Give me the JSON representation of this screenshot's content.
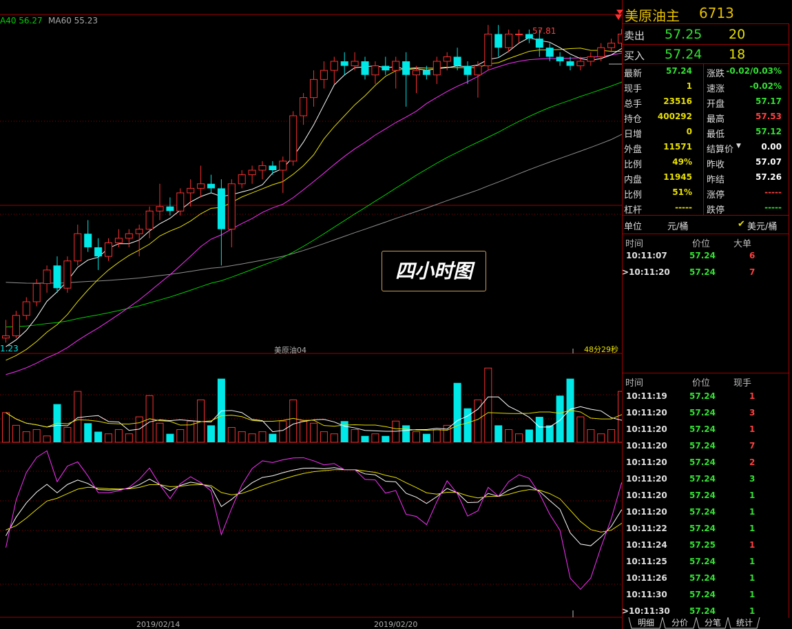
{
  "chart_header": {
    "ma40_label": "A40 56.27",
    "ma60_label": "MA60 55.23",
    "high_mark": "57.81",
    "low_mark": "1.23",
    "contract_label": "美原油04",
    "countdown": "48分29秒",
    "x_labels": [
      "2019/02/14",
      "2019/02/20"
    ]
  },
  "watermark": "四小时图",
  "colors": {
    "up": "#ff3030",
    "down": "#00e8e8",
    "ma5": "#ffffff",
    "ma10": "#e8e000",
    "ma20": "#ff30ff",
    "ma40": "#00d000",
    "ma60": "#909090",
    "grid": "#a00000"
  },
  "panel": {
    "title": "美原油主",
    "code": "6713",
    "ask_label": "卖出",
    "ask_price": "57.25",
    "ask_qty": "20",
    "bid_label": "买入",
    "bid_price": "57.24",
    "bid_qty": "18",
    "quote": [
      {
        "l": "最新",
        "v": "57.24",
        "c": "#33e033",
        "l2": "涨跌",
        "v2": "-0.02/0.03%",
        "c2": "#33e033"
      },
      {
        "l": "现手",
        "v": "1",
        "c": "#e8e000",
        "l2": "速涨",
        "v2": "-0.02%",
        "c2": "#33e033"
      },
      {
        "l": "总手",
        "v": "23516",
        "c": "#e8e000",
        "l2": "开盘",
        "v2": "57.17",
        "c2": "#33e033"
      },
      {
        "l": "持仓",
        "v": "400292",
        "c": "#e8e000",
        "l2": "最高",
        "v2": "57.53",
        "c2": "#ff4040"
      },
      {
        "l": "日增",
        "v": "0",
        "c": "#e8e000",
        "l2": "最低",
        "v2": "57.12",
        "c2": "#33e033"
      },
      {
        "l": "外盘",
        "v": "11571",
        "c": "#e8e000",
        "l2": "结算价",
        "v2": "0.00",
        "c2": "#ffffff"
      },
      {
        "l": "比例",
        "v": "49%",
        "c": "#e8e000",
        "l2": "昨收",
        "v2": "57.07",
        "c2": "#ffffff"
      },
      {
        "l": "内盘",
        "v": "11945",
        "c": "#e8e000",
        "l2": "昨结",
        "v2": "57.26",
        "c2": "#ffffff"
      },
      {
        "l": "比例",
        "v": "51%",
        "c": "#e8e000",
        "l2": "涨停",
        "v2": "-----",
        "c2": "#ff4040"
      },
      {
        "l": "杠杆",
        "v": "-----",
        "c": "#e8e000",
        "l2": "跌停",
        "v2": "-----",
        "c2": "#33e033"
      }
    ],
    "unit_label": "单位",
    "unit_a": "元/桶",
    "unit_b": "美元/桶",
    "big_head": [
      "时间",
      "价位",
      "大单"
    ],
    "big_orders": [
      {
        "t": "10:11:07",
        "p": "57.24",
        "q": "6",
        "qc": "#ff4040"
      },
      {
        "t": ">10:11:20",
        "p": "57.24",
        "q": "7",
        "qc": "#ff4040"
      }
    ],
    "tick_head": [
      "时间",
      "价位",
      "现手"
    ],
    "ticks": [
      {
        "t": "10:11:19",
        "p": "57.24",
        "q": "1",
        "qc": "#ff4040"
      },
      {
        "t": "10:11:20",
        "p": "57.24",
        "q": "3",
        "qc": "#ff4040"
      },
      {
        "t": "10:11:20",
        "p": "57.24",
        "q": "1",
        "qc": "#ff4040"
      },
      {
        "t": "10:11:20",
        "p": "57.24",
        "q": "7",
        "qc": "#ff4040"
      },
      {
        "t": "10:11:20",
        "p": "57.24",
        "q": "2",
        "qc": "#ff4040"
      },
      {
        "t": "10:11:20",
        "p": "57.24",
        "q": "3",
        "qc": "#33e033"
      },
      {
        "t": "10:11:20",
        "p": "57.24",
        "q": "1",
        "qc": "#33e033"
      },
      {
        "t": "10:11:20",
        "p": "57.24",
        "q": "1",
        "qc": "#33e033"
      },
      {
        "t": "10:11:22",
        "p": "57.24",
        "q": "1",
        "qc": "#33e033"
      },
      {
        "t": "10:11:24",
        "p": "57.25",
        "q": "1",
        "qc": "#ff4040"
      },
      {
        "t": "10:11:25",
        "p": "57.24",
        "q": "1",
        "qc": "#33e033"
      },
      {
        "t": "10:11:26",
        "p": "57.24",
        "q": "1",
        "qc": "#33e033"
      },
      {
        "t": "10:11:30",
        "p": "57.24",
        "q": "1",
        "qc": "#33e033"
      },
      {
        "t": ">10:11:30",
        "p": "57.24",
        "q": "1",
        "qc": "#33e033"
      }
    ],
    "tabs": [
      "明细",
      "分价",
      "分笔",
      "统计"
    ]
  },
  "chart_data": {
    "type": "candlestick",
    "candles": [
      [
        51.0,
        51.4,
        50.9,
        51.05
      ],
      [
        51.05,
        51.6,
        51.0,
        51.5
      ],
      [
        51.5,
        51.9,
        51.4,
        51.8
      ],
      [
        51.8,
        52.3,
        51.7,
        52.2
      ],
      [
        52.2,
        52.6,
        52.0,
        52.5
      ],
      [
        52.6,
        52.8,
        52.0,
        52.1
      ],
      [
        52.1,
        52.8,
        52.0,
        52.7
      ],
      [
        52.7,
        53.5,
        52.6,
        53.3
      ],
      [
        53.3,
        53.6,
        52.9,
        53.0
      ],
      [
        53.0,
        53.2,
        52.5,
        52.8
      ],
      [
        52.8,
        53.2,
        52.7,
        53.1
      ],
      [
        53.1,
        53.4,
        53.0,
        53.2
      ],
      [
        53.2,
        53.4,
        53.0,
        53.3
      ],
      [
        53.3,
        53.5,
        52.8,
        53.4
      ],
      [
        53.4,
        53.9,
        53.2,
        53.8
      ],
      [
        53.8,
        54.4,
        53.6,
        53.9
      ],
      [
        53.9,
        54.1,
        53.7,
        53.8
      ],
      [
        53.8,
        54.3,
        53.7,
        54.2
      ],
      [
        54.2,
        54.5,
        53.9,
        54.3
      ],
      [
        54.3,
        54.8,
        54.1,
        54.4
      ],
      [
        54.4,
        54.6,
        54.2,
        54.3
      ],
      [
        54.3,
        54.5,
        52.6,
        53.4
      ],
      [
        53.4,
        54.5,
        53.0,
        54.4
      ],
      [
        54.4,
        54.7,
        54.3,
        54.6
      ],
      [
        54.6,
        54.8,
        54.4,
        54.7
      ],
      [
        54.7,
        54.9,
        54.5,
        54.8
      ],
      [
        54.8,
        54.9,
        54.6,
        54.7
      ],
      [
        54.7,
        55.0,
        54.2,
        54.9
      ],
      [
        54.9,
        56.0,
        54.8,
        55.9
      ],
      [
        55.9,
        56.4,
        55.7,
        56.3
      ],
      [
        56.3,
        56.9,
        56.1,
        56.7
      ],
      [
        56.7,
        57.1,
        56.5,
        56.9
      ],
      [
        56.9,
        57.2,
        56.6,
        57.1
      ],
      [
        57.1,
        57.3,
        56.8,
        57.0
      ],
      [
        57.0,
        57.3,
        56.9,
        57.1
      ],
      [
        57.1,
        57.2,
        56.7,
        56.8
      ],
      [
        56.8,
        57.1,
        56.6,
        57.0
      ],
      [
        57.0,
        57.2,
        56.8,
        56.9
      ],
      [
        56.9,
        57.2,
        56.5,
        57.1
      ],
      [
        57.1,
        57.3,
        56.1,
        56.8
      ],
      [
        56.8,
        57.0,
        56.4,
        56.9
      ],
      [
        56.9,
        57.0,
        56.7,
        56.8
      ],
      [
        56.8,
        57.2,
        56.6,
        57.1
      ],
      [
        57.1,
        57.3,
        56.9,
        57.2
      ],
      [
        57.2,
        57.4,
        56.9,
        57.0
      ],
      [
        57.0,
        57.1,
        56.6,
        56.8
      ],
      [
        56.8,
        57.1,
        56.3,
        57.0
      ],
      [
        57.0,
        57.9,
        56.9,
        57.7
      ],
      [
        57.7,
        57.9,
        57.2,
        57.4
      ],
      [
        57.4,
        57.8,
        57.3,
        57.7
      ],
      [
        57.7,
        57.8,
        57.5,
        57.7
      ],
      [
        57.7,
        57.8,
        57.5,
        57.6
      ],
      [
        57.6,
        57.8,
        57.2,
        57.4
      ],
      [
        57.4,
        57.5,
        57.1,
        57.2
      ],
      [
        57.2,
        57.3,
        57.0,
        57.1
      ],
      [
        57.1,
        57.2,
        56.9,
        57.0
      ],
      [
        57.0,
        57.2,
        56.9,
        57.1
      ],
      [
        57.1,
        57.3,
        57.0,
        57.2
      ],
      [
        57.2,
        57.5,
        57.1,
        57.4
      ],
      [
        57.4,
        57.6,
        57.3,
        57.5
      ],
      [
        57.5,
        57.81,
        57.4,
        57.7
      ],
      [
        57.7,
        57.75,
        57.3,
        57.35
      ],
      [
        57.35,
        57.45,
        57.1,
        57.2
      ],
      [
        57.2,
        57.53,
        57.12,
        57.24
      ]
    ],
    "volume": [
      14,
      8,
      5,
      6,
      3,
      18,
      7,
      24,
      9,
      5,
      4,
      6,
      4,
      12,
      22,
      9,
      4,
      6,
      10,
      20,
      8,
      30,
      7,
      5,
      4,
      5,
      4,
      10,
      20,
      10,
      9,
      5,
      4,
      10,
      6,
      3,
      4,
      3,
      10,
      8,
      5,
      4,
      6,
      8,
      28,
      16,
      20,
      35,
      8,
      6,
      4,
      6,
      12,
      8,
      22,
      30,
      12,
      6,
      4,
      6,
      24,
      24,
      10,
      3
    ],
    "vol_ylim": [
      0,
      38
    ],
    "ylim": [
      50.95,
      57.95
    ],
    "kdj_ylim": [
      -10,
      110
    ]
  }
}
